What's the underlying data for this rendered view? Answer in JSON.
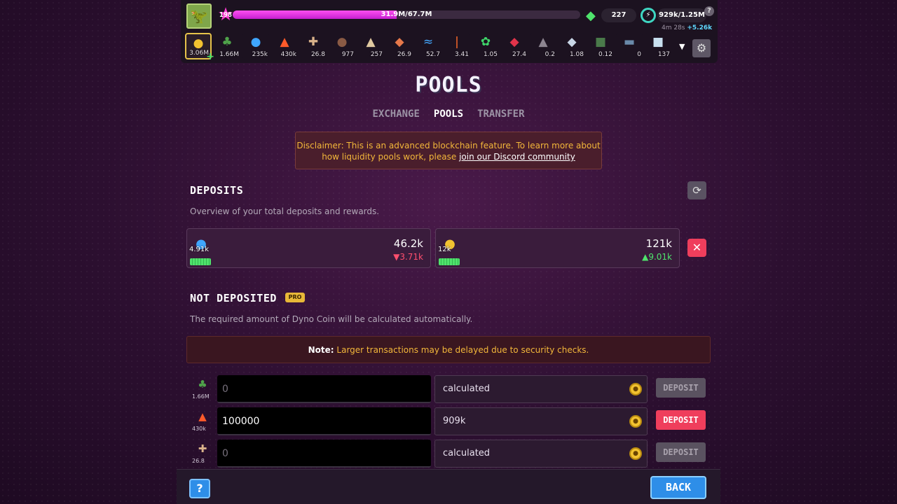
{
  "header": {
    "level": "198",
    "xp_text": "31.9M/67.7M",
    "xp_progress": 0.471,
    "gems": "227",
    "energy": "929k/1.25M",
    "energy_timer": "4m 28s",
    "energy_rate": "+5.26k",
    "help_small": "?"
  },
  "resources": [
    {
      "icon": "dyno-coin-icon",
      "glyph": "●",
      "color": "#f2c230",
      "amount": "3.06M",
      "active": true
    },
    {
      "icon": "grass-icon",
      "glyph": "♣",
      "color": "#4fa24a",
      "amount": "1.66M"
    },
    {
      "icon": "water-drop-icon",
      "glyph": "●",
      "color": "#3fa6ff",
      "amount": "235k"
    },
    {
      "icon": "fire-icon",
      "glyph": "▲",
      "color": "#ff5a2a",
      "amount": "430k"
    },
    {
      "icon": "bone-icon",
      "glyph": "✚",
      "color": "#d9b28a",
      "amount": "26.8"
    },
    {
      "icon": "rock-icon",
      "glyph": "●",
      "color": "#8a5a44",
      "amount": "977"
    },
    {
      "icon": "sand-icon",
      "glyph": "▲",
      "color": "#e0c9a0",
      "amount": "257"
    },
    {
      "icon": "meat-icon",
      "glyph": "◆",
      "color": "#e6784a",
      "amount": "26.9"
    },
    {
      "icon": "wave-icon",
      "glyph": "≈",
      "color": "#44a8ff",
      "amount": "52.7"
    },
    {
      "icon": "torch-icon",
      "glyph": "|",
      "color": "#ff6a2a",
      "amount": "3.41"
    },
    {
      "icon": "herb-icon",
      "glyph": "✿",
      "color": "#3fd66a",
      "amount": "1.05"
    },
    {
      "icon": "ruby-icon",
      "glyph": "◆",
      "color": "#e2334a",
      "amount": "27.4"
    },
    {
      "icon": "flask-icon",
      "glyph": "▲",
      "color": "#8c8490",
      "amount": "0.2"
    },
    {
      "icon": "crystal-icon",
      "glyph": "◆",
      "color": "#c8d6e6",
      "amount": "1.08"
    },
    {
      "icon": "canister-icon",
      "glyph": "■",
      "color": "#4a7a4a",
      "amount": "0.12"
    },
    {
      "icon": "plank-icon",
      "glyph": "▬",
      "color": "#6a8aaa",
      "amount": "0"
    },
    {
      "icon": "machine-icon",
      "glyph": "■",
      "color": "#c8e0f0",
      "amount": "137"
    }
  ],
  "title": "POOLS",
  "tabs": [
    {
      "label": "EXCHANGE",
      "active": false
    },
    {
      "label": "POOLS",
      "active": true
    },
    {
      "label": "TRANSFER",
      "active": false
    }
  ],
  "disclaimer": {
    "line1": "Disclaimer: This is an advanced blockchain feature. To learn more about",
    "line2_prefix": "how liquidity pools work, please ",
    "link": "join our Discord community"
  },
  "deposits": {
    "title": "DEPOSITS",
    "subtitle": "Overview of your total deposits and rewards.",
    "cards": [
      {
        "icon": "water-drop-icon",
        "glyph": "●",
        "color": "#3fa6ff",
        "amount": "4.91k",
        "value": "46.2k",
        "change": "3.71k",
        "direction": "down"
      },
      {
        "icon": "dyno-coin-icon",
        "glyph": "●",
        "color": "#f2c230",
        "amount": "12k",
        "value": "121k",
        "change": "9.01k",
        "direction": "up"
      }
    ]
  },
  "not_deposited": {
    "title": "NOT DEPOSITED",
    "badge": "PRO",
    "subtitle": "The required amount of Dyno Coin will be calculated automatically.",
    "note_label": "Note:",
    "note_text": "Larger transactions may be delayed due to security checks.",
    "rows": [
      {
        "icon": "grass-icon",
        "glyph": "♣",
        "color": "#4fa24a",
        "amount": "1.66M",
        "input": "0",
        "calc": "calculated",
        "button": "DEPOSIT",
        "enabled": false
      },
      {
        "icon": "fire-icon",
        "glyph": "▲",
        "color": "#ff5a2a",
        "amount": "430k",
        "input": "100000",
        "calc": "909k",
        "button": "DEPOSIT",
        "enabled": true
      },
      {
        "icon": "bone-icon",
        "glyph": "✚",
        "color": "#d9b28a",
        "amount": "26.8",
        "input": "0",
        "calc": "calculated",
        "button": "DEPOSIT",
        "enabled": false
      }
    ]
  },
  "footer": {
    "help": "?",
    "back": "BACK"
  }
}
